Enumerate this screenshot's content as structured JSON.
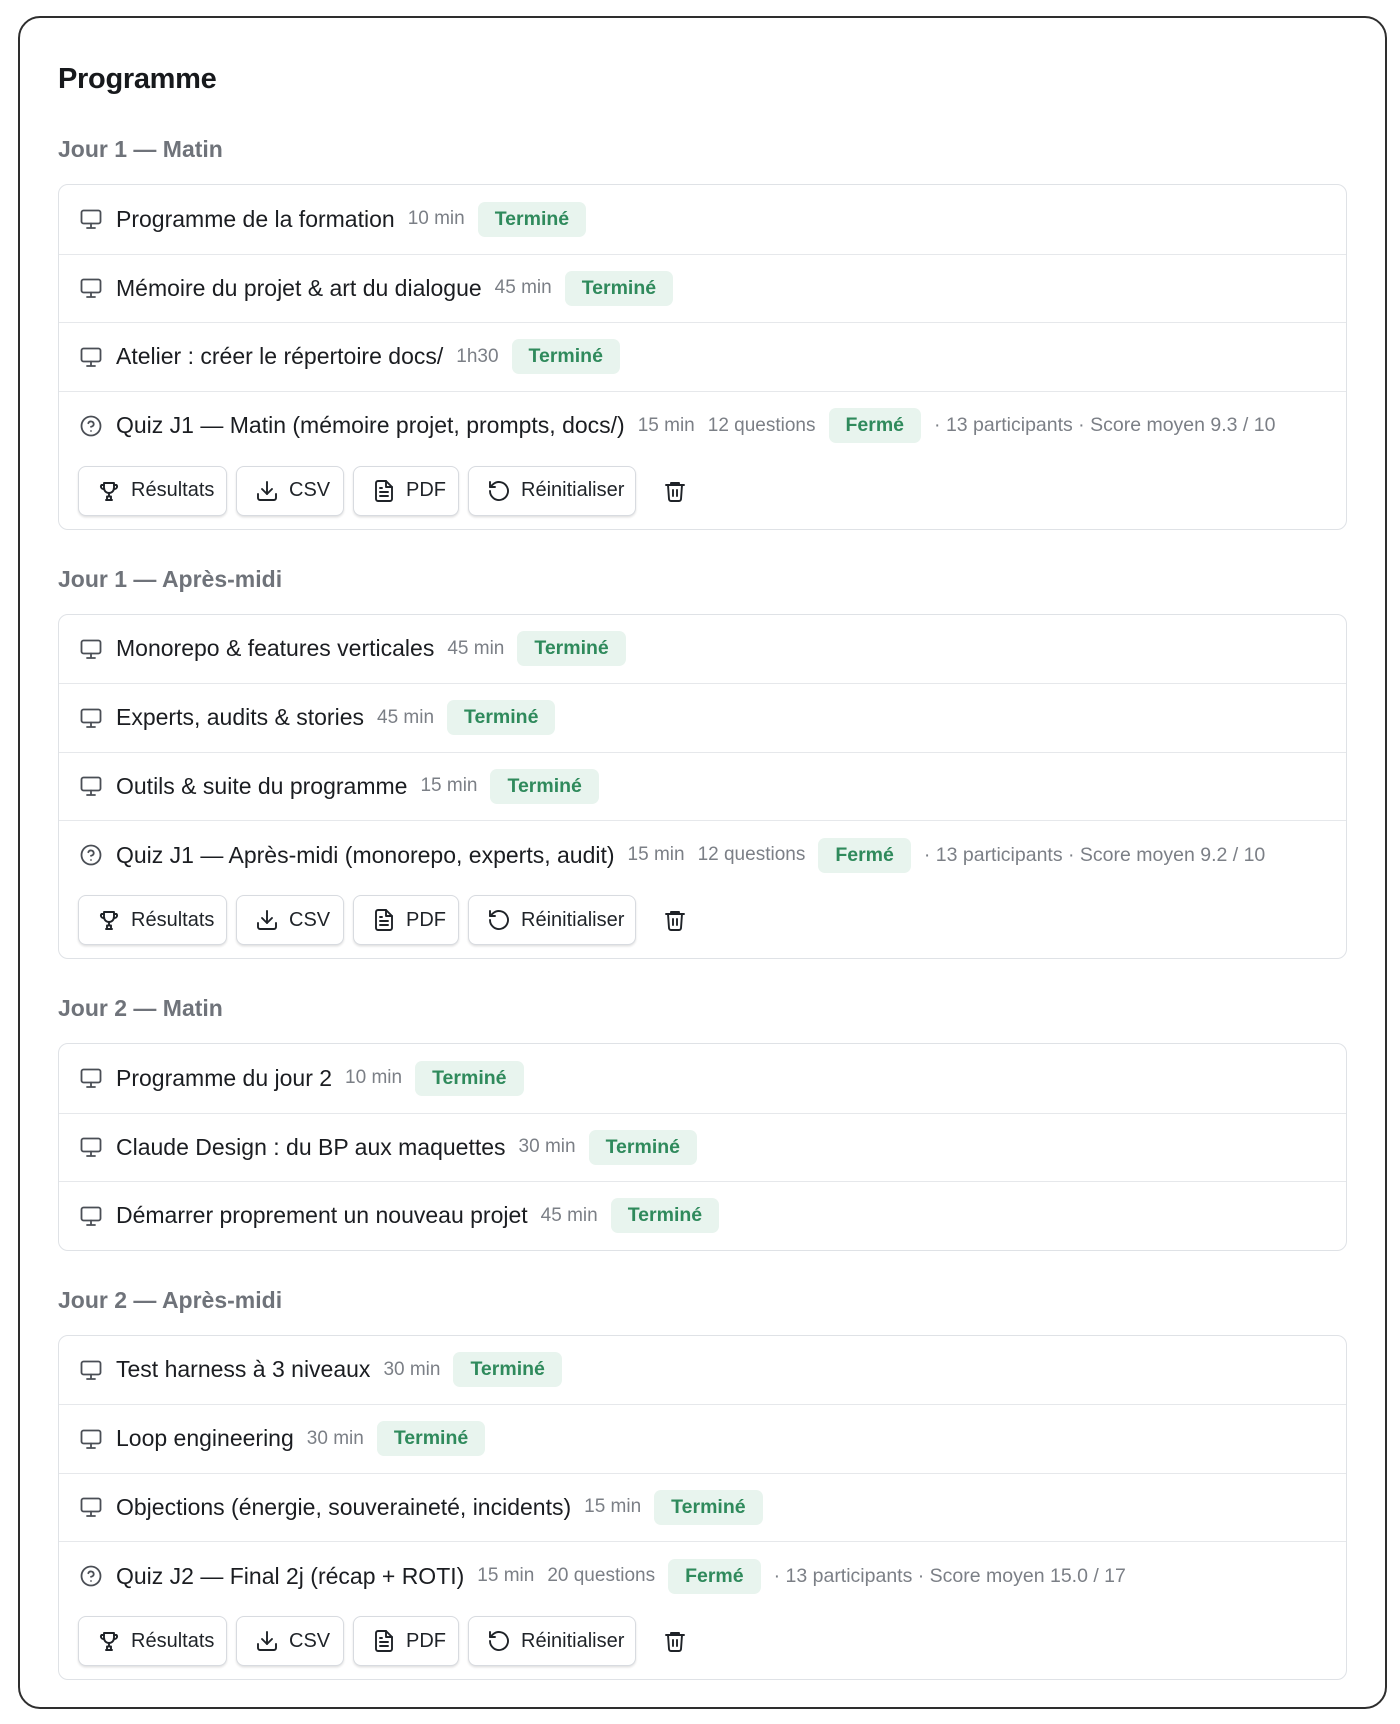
{
  "title": "Programme",
  "sections": [
    {
      "heading": "Jour 1 — Matin",
      "rows": [
        {
          "title": "Programme de la formation",
          "duration": "10 min",
          "status": "Terminé"
        },
        {
          "title": "Mémoire du projet & art du dialogue",
          "duration": "45 min",
          "status": "Terminé"
        },
        {
          "title": "Atelier : créer le répertoire docs/",
          "duration": "1h30",
          "status": "Terminé"
        }
      ],
      "quiz": {
        "title": "Quiz J1 — Matin (mémoire projet, prompts, docs/)",
        "duration": "15 min",
        "questions": "12 questions",
        "status": "Fermé",
        "stats": "· 13 participants · Score moyen 9.3 / 10"
      }
    },
    {
      "heading": "Jour 1 — Après-midi",
      "rows": [
        {
          "title": "Monorepo & features verticales",
          "duration": "45 min",
          "status": "Terminé"
        },
        {
          "title": "Experts, audits & stories",
          "duration": "45 min",
          "status": "Terminé"
        },
        {
          "title": "Outils & suite du programme",
          "duration": "15 min",
          "status": "Terminé"
        }
      ],
      "quiz": {
        "title": "Quiz J1 — Après-midi (monorepo, experts, audit)",
        "duration": "15 min",
        "questions": "12 questions",
        "status": "Fermé",
        "stats": "· 13 participants · Score moyen 9.2 / 10"
      }
    },
    {
      "heading": "Jour 2 — Matin",
      "rows": [
        {
          "title": "Programme du jour 2",
          "duration": "10 min",
          "status": "Terminé"
        },
        {
          "title": "Claude Design : du BP aux maquettes",
          "duration": "30 min",
          "status": "Terminé"
        },
        {
          "title": "Démarrer proprement un nouveau projet",
          "duration": "45 min",
          "status": "Terminé"
        }
      ]
    },
    {
      "heading": "Jour 2 — Après-midi",
      "rows": [
        {
          "title": "Test harness à 3 niveaux",
          "duration": "30 min",
          "status": "Terminé"
        },
        {
          "title": "Loop engineering",
          "duration": "30 min",
          "status": "Terminé"
        },
        {
          "title": "Objections (énergie, souveraineté, incidents)",
          "duration": "15 min",
          "status": "Terminé"
        }
      ],
      "quiz": {
        "title": "Quiz J2 — Final 2j (récap + ROTI)",
        "duration": "15 min",
        "questions": "20 questions",
        "status": "Fermé",
        "stats": "· 13 participants · Score moyen 15.0 / 17"
      }
    }
  ],
  "actions": {
    "results": "Résultats",
    "csv": "CSV",
    "pdf": "PDF",
    "reset": "Réinitialiser"
  },
  "icons": {
    "row": "monitor-icon",
    "quiz": "question-circle-icon",
    "results": "trophy-icon",
    "csv": "download-icon",
    "pdf": "file-text-icon",
    "reset": "rotate-ccw-icon",
    "delete": "trash-icon"
  },
  "colors": {
    "badge_bg": "#e8f4ee",
    "badge_text": "#2f8a5c",
    "muted_text": "#7b7f86",
    "section_heading": "#6f737a"
  }
}
